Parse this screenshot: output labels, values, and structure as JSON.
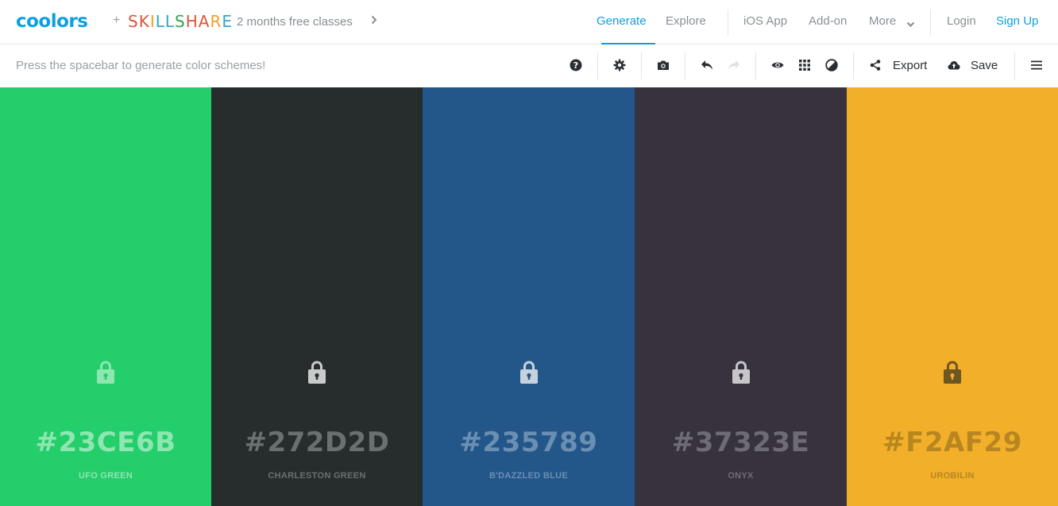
{
  "nav": {
    "brand": "coolors",
    "plus": "+",
    "partner_letters": [
      {
        "ch": "S",
        "color": "#e0533a"
      },
      {
        "ch": "K",
        "color": "#e0533a"
      },
      {
        "ch": "I",
        "color": "#f0a028"
      },
      {
        "ch": "L",
        "color": "#35a6c7"
      },
      {
        "ch": "L",
        "color": "#35a6c7"
      },
      {
        "ch": "S",
        "color": "#2ba84a"
      },
      {
        "ch": "H",
        "color": "#e0533a"
      },
      {
        "ch": "A",
        "color": "#e0533a"
      },
      {
        "ch": "R",
        "color": "#f0a028"
      },
      {
        "ch": "E",
        "color": "#35a6c7"
      }
    ],
    "promo": "2 months free classes",
    "generate": "Generate",
    "explore": "Explore",
    "ios_app": "iOS App",
    "addon": "Add-on",
    "more": "More",
    "login": "Login",
    "signup": "Sign Up"
  },
  "toolbar": {
    "hint": "Press the spacebar to generate color schemes!",
    "export": "Export",
    "save": "Save"
  },
  "colors": {
    "accent": "#0da0e0"
  },
  "swatches": [
    {
      "hex": "#23CE6B",
      "name": "UFO GREEN",
      "bg": "#23CE6B",
      "fg": "#8ee6b0",
      "lock_color": "#8ee6b0"
    },
    {
      "hex": "#272D2D",
      "name": "CHARLESTON GREEN",
      "bg": "#272D2D",
      "fg": "#6a6f6f",
      "lock_color": "#c9cbcb"
    },
    {
      "hex": "#235789",
      "name": "B'DAZZLED BLUE",
      "bg": "#235789",
      "fg": "#6b8fb3",
      "lock_color": "#c6d2de"
    },
    {
      "hex": "#37323E",
      "name": "ONYX",
      "bg": "#37323E",
      "fg": "#6f6b75",
      "lock_color": "#c7c5ca"
    },
    {
      "hex": "#F2AF29",
      "name": "UROBILIN",
      "bg": "#F2AF29",
      "fg": "#b88620",
      "lock_color": "#6e5524"
    }
  ]
}
